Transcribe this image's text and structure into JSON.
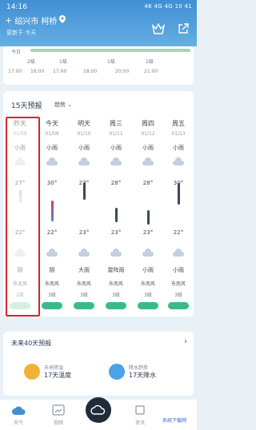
{
  "status_bar": {
    "time": "14:16",
    "right": "46 4G 4G 10 41"
  },
  "location": {
    "name": "绍兴市 柯桥",
    "sub": "更新于 今天"
  },
  "hourly": {
    "label": "今日",
    "winds": [
      "2级",
      "1级",
      "1级",
      "1级"
    ],
    "times": [
      "17:00",
      "16:00",
      "17:00",
      "18:00",
      "20:00",
      "21:00"
    ]
  },
  "forecast": {
    "title": "15天预报",
    "mode": "趋势",
    "days": [
      {
        "name": "昨天",
        "date": "01/08",
        "cond": "小雨",
        "hi": "27°",
        "lo": "22°",
        "wind": "东北风",
        "wlvl": "2级"
      },
      {
        "name": "今天",
        "date": "01/09",
        "cond": "小雨",
        "hi": "30°",
        "lo": "22°",
        "wind": "东南风",
        "wlvl": "3级"
      },
      {
        "name": "明天",
        "date": "01/10",
        "cond": "小雨",
        "hi": "27°",
        "lo": "23°",
        "wind": "东南风",
        "wlvl": "3级"
      },
      {
        "name": "周三",
        "date": "01/11",
        "cond": "小雨",
        "hi": "28°",
        "lo": "23°",
        "wind": "东南风",
        "wlvl": "3级"
      },
      {
        "name": "周四",
        "date": "01/12",
        "cond": "小雨",
        "hi": "28°",
        "lo": "23°",
        "wind": "东南风",
        "wlvl": "3级"
      },
      {
        "name": "周五",
        "date": "01/13",
        "cond": "小雨",
        "hi": "30°",
        "lo": "22°",
        "wind": "东南风",
        "wlvl": "3级"
      }
    ],
    "afternoon_cond": [
      "阴",
      "阴",
      "大雨",
      "雷阵雨",
      "小雨",
      "小雨"
    ]
  },
  "fc40": {
    "title": "未来40天预报",
    "items": [
      {
        "name": "未来降温",
        "value": "17天温度"
      },
      {
        "name": "降水趋势",
        "value": "17天降水"
      }
    ]
  },
  "nav": {
    "items": [
      "天气",
      "视频",
      "",
      "资讯"
    ],
    "watermark": "系统下载网"
  }
}
